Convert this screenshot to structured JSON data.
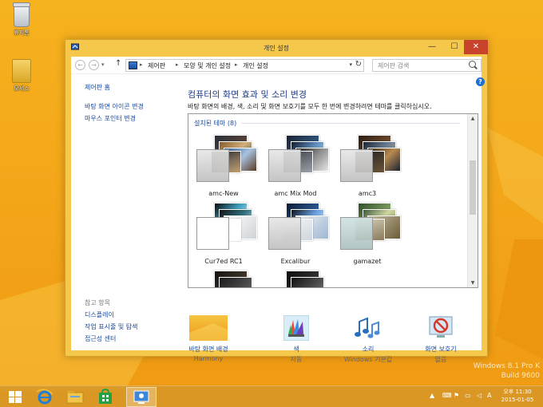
{
  "desktop": {
    "icons": [
      {
        "label": "휴지통",
        "icon": "recycle-bin-icon"
      },
      {
        "label": "모세스",
        "icon": "folder-icon"
      }
    ],
    "watermark": {
      "line1": "Windows 8.1 Pro K",
      "line2": "Build 9600"
    }
  },
  "window": {
    "title": "개인 설정",
    "controls": {
      "minimize": "—",
      "maximize": "☐",
      "close": "✕"
    }
  },
  "navbar": {
    "back_glyph": "←",
    "forward_glyph": "→",
    "up_glyph": "↑",
    "breadcrumbs": [
      "제어판",
      "모양 및 개인 설정",
      "개인 설정"
    ],
    "separator": "▸",
    "search_placeholder": "제어판 검색"
  },
  "left_pane": {
    "home": "제어판 홈",
    "links": [
      "바탕 화면 아이콘 변경",
      "마우스 포인터 변경"
    ],
    "see_also_label": "참고 항목",
    "see_also": [
      "디스플레이",
      "작업 표시줄 및 탐색",
      "접근성 센터"
    ]
  },
  "main": {
    "heading": "컴퓨터의 화면 효과 및 소리 변경",
    "description": "바탕 화면의 배경, 색, 소리 및 화면 보호기를 모두 한 번에 변경하려면 테마를 클릭하십시오.",
    "group_title": "설치된 테마 (8)",
    "themes": [
      {
        "name": "amc-New"
      },
      {
        "name": "amc Mix Mod"
      },
      {
        "name": "amc3"
      },
      {
        "name": "Cur7ed RC1"
      },
      {
        "name": "Excalibur"
      },
      {
        "name": "gamazet"
      },
      {
        "name": ""
      },
      {
        "name": ""
      }
    ]
  },
  "bottom": [
    {
      "label": "바탕 화면 배경",
      "sub": "Harmony",
      "icon": "desktop-background-icon"
    },
    {
      "label": "색",
      "sub": "자동",
      "icon": "color-icon"
    },
    {
      "label": "소리",
      "sub": "Windows 기본값",
      "icon": "sound-icon"
    },
    {
      "label": "화면 보호기",
      "sub": "없음",
      "icon": "screensaver-icon"
    }
  ],
  "taskbar": {
    "time": "오후 11:30",
    "date": "2015-01-05"
  },
  "colors": {
    "accent": "#f3a418",
    "link": "#1a4aa0",
    "heading": "#1f3c88",
    "close": "#c7432b"
  }
}
